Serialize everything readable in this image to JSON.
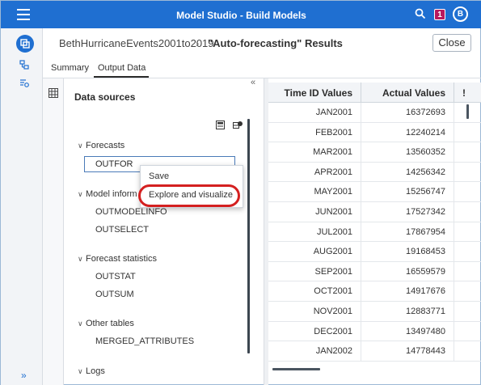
{
  "app": {
    "title": "Model Studio - Build Models",
    "notification_count": "1",
    "avatar_initial": "B"
  },
  "header": {
    "breadcrumb": "BethHurricaneEvents2001to2019",
    "separator": "›",
    "results_title": "\"Auto-forecasting\" Results",
    "close_label": "Close"
  },
  "tabs": [
    {
      "label": "Summary",
      "active": false
    },
    {
      "label": "Output Data",
      "active": true
    }
  ],
  "panel": {
    "title": "Data sources",
    "collapse_glyph": "«",
    "sections": [
      {
        "label": "Forecasts",
        "items": [
          "OUTFOR"
        ]
      },
      {
        "label": "Model inform",
        "items": [
          "OUTMODELINFO",
          "OUTSELECT"
        ]
      },
      {
        "label": "Forecast statistics",
        "items": [
          "OUTSTAT",
          "OUTSUM"
        ]
      },
      {
        "label": "Other tables",
        "items": [
          "MERGED_ATTRIBUTES"
        ]
      },
      {
        "label": "Logs",
        "items": []
      }
    ]
  },
  "context_menu": {
    "items": [
      "Save",
      "Explore and visualize"
    ],
    "highlighted": "Explore and visualize",
    "highlight_color": "#d42020"
  },
  "table": {
    "columns": [
      "Time ID Values",
      "Actual Values",
      "!"
    ],
    "rows": [
      [
        "JAN2001",
        "16372693"
      ],
      [
        "FEB2001",
        "12240214"
      ],
      [
        "MAR2001",
        "13560352"
      ],
      [
        "APR2001",
        "14256342"
      ],
      [
        "MAY2001",
        "15256747"
      ],
      [
        "JUN2001",
        "17527342"
      ],
      [
        "JUL2001",
        "17867954"
      ],
      [
        "AUG2001",
        "19168453"
      ],
      [
        "SEP2001",
        "16559579"
      ],
      [
        "OCT2001",
        "14917676"
      ],
      [
        "NOV2001",
        "12883771"
      ],
      [
        "DEC2001",
        "13497480"
      ],
      [
        "JAN2002",
        "14778443"
      ]
    ]
  },
  "rail": {
    "expand_glyph": "»",
    "icons": [
      "pipeline-icon",
      "nodes-icon",
      "data-settings-icon"
    ]
  },
  "colors": {
    "accent": "#1f6fd1",
    "notification": "#b8195e"
  }
}
